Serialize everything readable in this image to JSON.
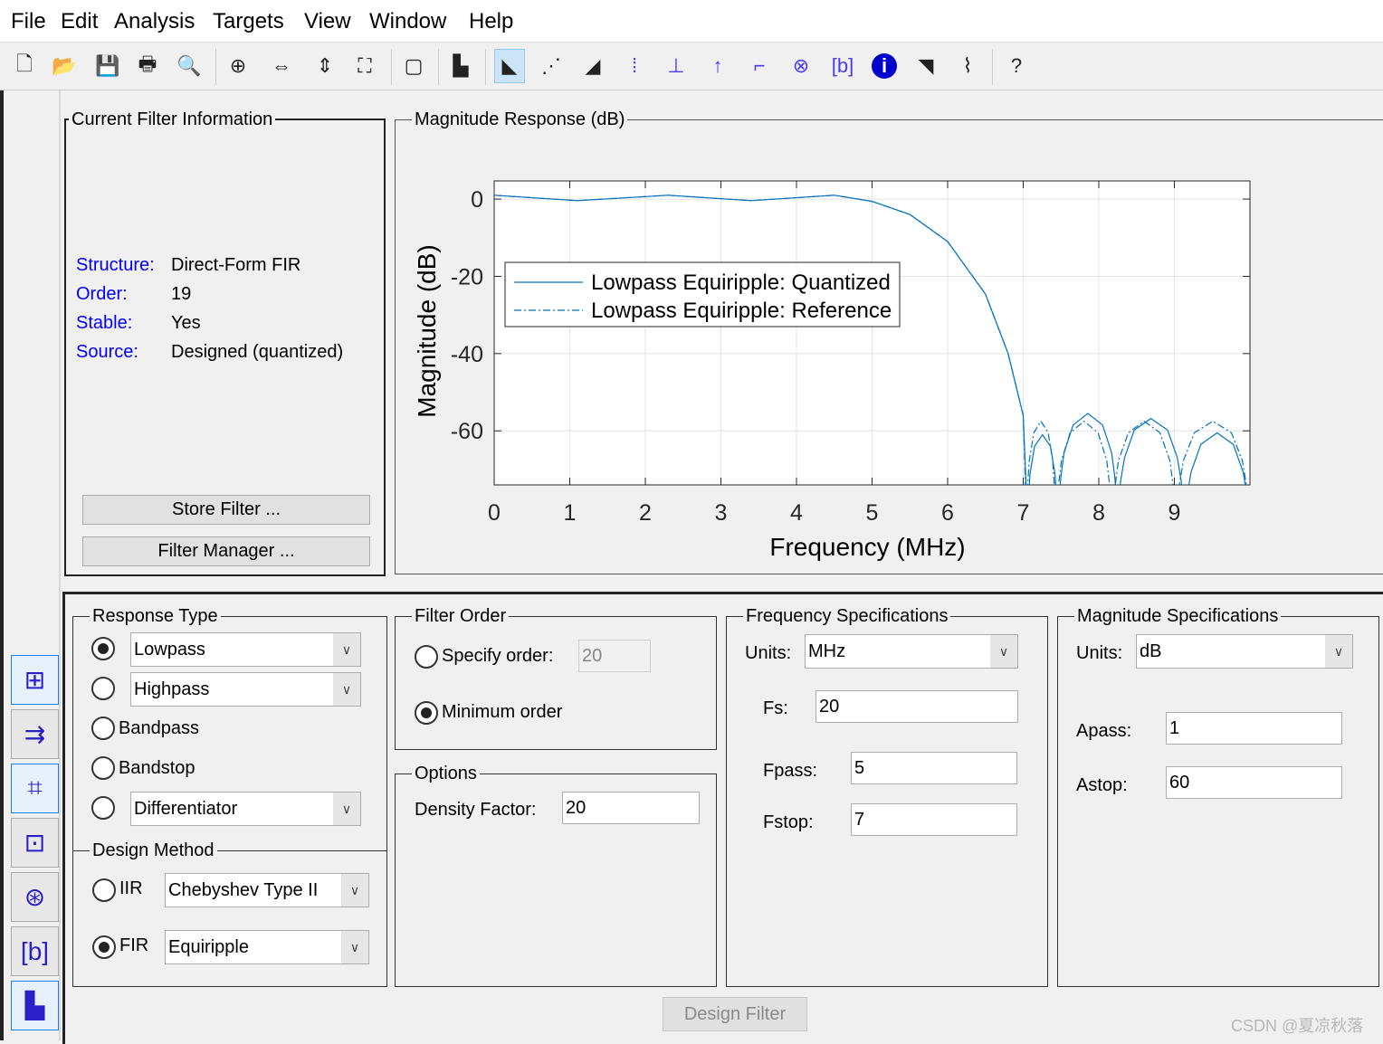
{
  "menu": [
    "File",
    "Edit",
    "Analysis",
    "Targets",
    "View",
    "Window",
    "Help"
  ],
  "toolbar": {
    "icons": [
      "new-icon",
      "open-icon",
      "save-icon",
      "print-icon",
      "print-preview-icon",
      "zoom-in-icon",
      "zoom-x-icon",
      "zoom-y-icon",
      "full-view-icon",
      "new-figure-icon",
      "filter-specs-icon",
      "magnitude-response-icon",
      "phase-response-icon",
      "magnitude-phase-icon",
      "group-delay-icon",
      "phase-delay-icon",
      "impulse-response-icon",
      "step-response-icon",
      "pole-zero-icon",
      "filter-coefficients-icon",
      "filter-info-icon",
      "magnitude-estimate-icon",
      "round-off-noise-icon",
      "whats-this-icon"
    ],
    "active": "magnitude-response-icon"
  },
  "sidebar": {
    "items": [
      "transform-filter-icon",
      "convert-structure-icon",
      "set-quantization-icon",
      "realize-model-icon",
      "pole-zero-editor-icon",
      "import-filter-icon",
      "design-filter-icon"
    ],
    "selected": "design-filter-icon"
  },
  "filter_info": {
    "title": "Current Filter Information",
    "rows": [
      {
        "label": "Structure:",
        "value": "Direct-Form FIR"
      },
      {
        "label": "Order:",
        "value": "19"
      },
      {
        "label": "Stable:",
        "value": "Yes"
      },
      {
        "label": "Source:",
        "value": "Designed (quantized)"
      }
    ],
    "store_button": "Store Filter ...",
    "manager_button": "Filter Manager ..."
  },
  "plot_panel": {
    "title": "Magnitude Response (dB)"
  },
  "chart_data": {
    "type": "line",
    "xlabel": "Frequency (MHz)",
    "ylabel": "Magnitude (dB)",
    "xlim": [
      0,
      10
    ],
    "ylim": [
      -74,
      4.7
    ],
    "xticks": [
      "0",
      "1",
      "2",
      "3",
      "4",
      "5",
      "6",
      "7",
      "8",
      "9"
    ],
    "yticks": [
      "0",
      "-20",
      "-40",
      "-60"
    ],
    "grid": true,
    "legend_position": "upper-left",
    "color": "#0072bd",
    "series": [
      {
        "name": "Lowpass Equiripple: Quantized",
        "style": "solid",
        "x": [
          0,
          0.55,
          1.1,
          1.7,
          2.3,
          2.85,
          3.4,
          3.95,
          4.5,
          5,
          5.5,
          6,
          6.5,
          6.8,
          7,
          7.05,
          7.07,
          7.09,
          7.15,
          7.255,
          7.36,
          7.42,
          7.44,
          7.46,
          7.5,
          7.54,
          7.66,
          7.855,
          8.05,
          8.17,
          8.21,
          8.25,
          8.29,
          8.34,
          8.47,
          8.69,
          8.91,
          9.04,
          9.09,
          9.13,
          9.17,
          9.22,
          9.35,
          9.565,
          9.78,
          9.91,
          9.96,
          10
        ],
        "y": [
          1,
          0.3,
          -0.4,
          0.3,
          1,
          0.3,
          -0.4,
          0.3,
          1,
          -0.6,
          -4,
          -11,
          -24.6,
          -40,
          -56,
          -80,
          -77.1,
          -71.2,
          -64,
          -61,
          -64,
          -71.2,
          -77.1,
          -80,
          -71.6,
          -65.7,
          -58.5,
          -55.5,
          -58.5,
          -65.7,
          -71.6,
          -80,
          -72.9,
          -67,
          -59.8,
          -56.8,
          -59.8,
          -67,
          -72.9,
          -80,
          -76.6,
          -70.7,
          -63.5,
          -60.5,
          -63.5,
          -70.7,
          -76.6,
          -80
        ]
      },
      {
        "name": "Lowpass Equiripple: Reference",
        "style": "dashdot",
        "x": [
          0,
          0.55,
          1.1,
          1.7,
          2.3,
          2.85,
          3.4,
          3.95,
          4.5,
          5,
          5.5,
          6,
          6.5,
          6.8,
          7,
          7.04,
          7.06,
          7.08,
          7.14,
          7.235,
          7.33,
          7.39,
          7.41,
          7.43,
          7.47,
          7.505,
          7.62,
          7.805,
          7.99,
          8.105,
          8.14,
          8.18,
          8.22,
          8.26,
          8.39,
          8.6,
          8.81,
          8.94,
          8.98,
          9.02,
          9.07,
          9.12,
          9.265,
          9.51,
          9.755,
          9.9,
          9.95,
          10
        ],
        "y": [
          1,
          0.3,
          -0.4,
          0.3,
          1,
          0.3,
          -0.4,
          0.3,
          1,
          -0.6,
          -4,
          -11,
          -24.6,
          -40,
          -56,
          -80,
          -73.6,
          -67.7,
          -60.5,
          -57.5,
          -60.5,
          -67.7,
          -73.6,
          -80,
          -73.6,
          -67.7,
          -60.5,
          -57.5,
          -60.5,
          -67.7,
          -73.6,
          -80,
          -73.6,
          -67.7,
          -60.5,
          -57.5,
          -60.5,
          -67.7,
          -73.6,
          -80,
          -73.6,
          -67.7,
          -60.5,
          -57.5,
          -60.5,
          -67.7,
          -73.6,
          -80
        ]
      }
    ]
  },
  "response_type": {
    "title": "Response Type",
    "selected": "Lowpass",
    "options": [
      {
        "label": "Lowpass",
        "dropdown": true,
        "checked": true
      },
      {
        "label": "Highpass",
        "dropdown": true,
        "checked": false
      },
      {
        "label": "Bandpass",
        "dropdown": false,
        "checked": false
      },
      {
        "label": "Bandstop",
        "dropdown": false,
        "checked": false
      },
      {
        "label": "Differentiator",
        "dropdown": true,
        "checked": false
      }
    ]
  },
  "design_method": {
    "title": "Design Method",
    "iir_label": "IIR",
    "iir_value": "Chebyshev Type II",
    "iir_checked": false,
    "fir_label": "FIR",
    "fir_value": "Equiripple",
    "fir_checked": true
  },
  "filter_order": {
    "title": "Filter Order",
    "specify_label": "Specify order:",
    "specify_value": "20",
    "minimum_label": "Minimum order",
    "selected": "Minimum order"
  },
  "options": {
    "title": "Options",
    "density_label": "Density Factor:",
    "density_value": "20"
  },
  "freq_specs": {
    "title": "Frequency Specifications",
    "units_label": "Units:",
    "units_value": "MHz",
    "fields": [
      {
        "label": "Fs:",
        "value": "20"
      },
      {
        "label": "Fpass:",
        "value": "5"
      },
      {
        "label": "Fstop:",
        "value": "7"
      }
    ]
  },
  "mag_specs": {
    "title": "Magnitude Specifications",
    "units_label": "Units:",
    "units_value": "dB",
    "fields": [
      {
        "label": "Apass:",
        "value": "1"
      },
      {
        "label": "Astop:",
        "value": "60"
      }
    ]
  },
  "design_button": "Design Filter",
  "watermark": "CSDN @夏凉秋落"
}
